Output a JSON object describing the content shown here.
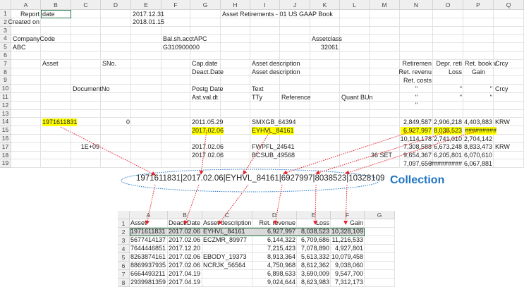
{
  "top_sheet": {
    "columns": [
      "A",
      "B",
      "C",
      "D",
      "E",
      "F",
      "G",
      "H",
      "I",
      "J",
      "K",
      "L",
      "M",
      "N",
      "O",
      "P",
      "Q"
    ],
    "rows": 19,
    "cells": [
      {
        "r": 1,
        "c": "A",
        "v": "Report",
        "a": "r"
      },
      {
        "r": 1,
        "c": "B",
        "v": "date"
      },
      {
        "r": 1,
        "c": "E",
        "v": "2017.12.31"
      },
      {
        "r": 1,
        "c": "H",
        "v": "Asset Retirements - 01 US GAAP Book"
      },
      {
        "r": 2,
        "c": "A",
        "v": "Created on",
        "a": "r"
      },
      {
        "r": 2,
        "c": "E",
        "v": "2018.01.15"
      },
      {
        "r": 4,
        "c": "A",
        "v": "CompanyCode"
      },
      {
        "r": 4,
        "c": "F",
        "v": "Bal.sh.acctAPC"
      },
      {
        "r": 4,
        "c": "K",
        "v": "Assetclass"
      },
      {
        "r": 5,
        "c": "A",
        "v": "ABC"
      },
      {
        "r": 5,
        "c": "F",
        "v": "G310900000"
      },
      {
        "r": 5,
        "c": "K",
        "v": "32061",
        "a": "r"
      },
      {
        "r": 7,
        "c": "B",
        "v": "Asset"
      },
      {
        "r": 7,
        "c": "D",
        "v": "SNo."
      },
      {
        "r": 7,
        "c": "G",
        "v": "Cap.date"
      },
      {
        "r": 7,
        "c": "I",
        "v": "Asset description"
      },
      {
        "r": 7,
        "c": "N",
        "v": "Retiremen",
        "a": "r"
      },
      {
        "r": 7,
        "c": "O",
        "v": "Depr. reti",
        "a": "r"
      },
      {
        "r": 7,
        "c": "P",
        "v": "Ret. book v"
      },
      {
        "r": 7,
        "c": "Q",
        "v": "Crcy"
      },
      {
        "r": 8,
        "c": "G",
        "v": "Deact.Date"
      },
      {
        "r": 8,
        "c": "I",
        "v": "Asset description"
      },
      {
        "r": 8,
        "c": "N",
        "v": "Ret. revenu",
        "a": "r"
      },
      {
        "r": 8,
        "c": "O",
        "v": "Loss",
        "a": "r"
      },
      {
        "r": 8,
        "c": "P",
        "v": "Gain",
        "a": "c"
      },
      {
        "r": 9,
        "c": "N",
        "v": "Ret. costs",
        "a": "r"
      },
      {
        "r": 10,
        "c": "C",
        "v": "DocumentNo"
      },
      {
        "r": 10,
        "c": "G",
        "v": "Postg Date"
      },
      {
        "r": 10,
        "c": "I",
        "v": "Text"
      },
      {
        "r": 10,
        "c": "N",
        "v": "\"",
        "a": "c"
      },
      {
        "r": 10,
        "c": "O",
        "v": "\"",
        "a": "r"
      },
      {
        "r": 10,
        "c": "P",
        "v": "\"",
        "a": "r"
      },
      {
        "r": 10,
        "c": "Q",
        "v": "Crcy"
      },
      {
        "r": 11,
        "c": "G",
        "v": "Ast.val.dt"
      },
      {
        "r": 11,
        "c": "I",
        "v": "TTy"
      },
      {
        "r": 11,
        "c": "J",
        "v": "Reference"
      },
      {
        "r": 11,
        "c": "L",
        "v": "Quant BUn"
      },
      {
        "r": 11,
        "c": "N",
        "v": "\"",
        "a": "c"
      },
      {
        "r": 11,
        "c": "O",
        "v": "\"",
        "a": "r"
      },
      {
        "r": 11,
        "c": "P",
        "v": "\"",
        "a": "r"
      },
      {
        "r": 12,
        "c": "N",
        "v": "\"",
        "a": "c"
      },
      {
        "r": 14,
        "c": "B",
        "v": "1971611831",
        "hl": true
      },
      {
        "r": 14,
        "c": "D",
        "v": "0",
        "a": "r"
      },
      {
        "r": 14,
        "c": "G",
        "v": "2011.05.29"
      },
      {
        "r": 14,
        "c": "I",
        "v": "SMXGB_64394"
      },
      {
        "r": 14,
        "c": "N",
        "v": "2,849,587",
        "a": "r"
      },
      {
        "r": 14,
        "c": "O",
        "v": "2,906,218",
        "a": "r"
      },
      {
        "r": 14,
        "c": "P",
        "v": "4,403,883",
        "a": "r"
      },
      {
        "r": 14,
        "c": "Q",
        "v": "KRW"
      },
      {
        "r": 15,
        "c": "G",
        "v": "2017.02.06",
        "hl": true
      },
      {
        "r": 15,
        "c": "I",
        "v": "EYHVL_84161",
        "hl": true
      },
      {
        "r": 15,
        "c": "N",
        "v": "6,927,997",
        "a": "r",
        "hl": true
      },
      {
        "r": 15,
        "c": "O",
        "v": "8,038,523",
        "a": "r",
        "hl": true
      },
      {
        "r": 15,
        "c": "P",
        "v": "#########",
        "hl": true
      },
      {
        "r": 16,
        "c": "N",
        "v": "10,114,178",
        "a": "r"
      },
      {
        "r": 16,
        "c": "O",
        "v": "2,741,010",
        "a": "r"
      },
      {
        "r": 16,
        "c": "P",
        "v": "2,704,142",
        "a": "r"
      },
      {
        "r": 17,
        "c": "C",
        "v": "1E+09",
        "a": "r"
      },
      {
        "r": 17,
        "c": "G",
        "v": "2017.02.06"
      },
      {
        "r": 17,
        "c": "I",
        "v": "FWPFL_24541"
      },
      {
        "r": 17,
        "c": "N",
        "v": "7,308,588",
        "a": "r"
      },
      {
        "r": 17,
        "c": "O",
        "v": "6,673,248",
        "a": "r"
      },
      {
        "r": 17,
        "c": "P",
        "v": "8,833,473",
        "a": "r"
      },
      {
        "r": 17,
        "c": "Q",
        "v": "KRW"
      },
      {
        "r": 18,
        "c": "G",
        "v": "2017.02.06"
      },
      {
        "r": 18,
        "c": "I",
        "v": "BCSUB_49568"
      },
      {
        "r": 18,
        "c": "M",
        "v": "36 SET"
      },
      {
        "r": 18,
        "c": "N",
        "v": "9,654,367",
        "a": "r"
      },
      {
        "r": 18,
        "c": "O",
        "v": "6,205,801",
        "a": "r"
      },
      {
        "r": 18,
        "c": "P",
        "v": "6,070,610",
        "a": "r"
      },
      {
        "r": 19,
        "c": "N",
        "v": "7,097,656",
        "a": "r"
      },
      {
        "r": 19,
        "c": "O",
        "v": "#########",
        "a": "r"
      },
      {
        "r": 19,
        "c": "P",
        "v": "6,067,881",
        "a": "r"
      }
    ]
  },
  "collection": {
    "string": "1971611831|2017.02.06|EYHVL_84161|6927997|8038523|10328109",
    "label": "Collection"
  },
  "bottom_sheet": {
    "columns": [
      "A",
      "B",
      "C",
      "D",
      "E",
      "F",
      "G"
    ],
    "header": [
      "Asset",
      "Deact.Date",
      "Asset description",
      "Ret. revenue",
      "Loss",
      "Gain"
    ],
    "rows": [
      [
        "1971611831",
        "2017.02.06",
        "EYHVL_84161",
        "6,927,997",
        "8,038,523",
        "10,328,109"
      ],
      [
        "5677414137",
        "2017.02.06",
        "ECZMR_89977",
        "6,144,322",
        "6,709,686",
        "11,216,533"
      ],
      [
        "7644446851",
        "2017.12.20",
        "",
        "7,215,423",
        "7,078,890",
        "4,927,801"
      ],
      [
        "8263874161",
        "2017.02.06",
        "EBODY_19373",
        "8,913,364",
        "5,613,332",
        "10,079,458"
      ],
      [
        "8869937935",
        "2017.02.06",
        "NCRJK_56564",
        "4,750,968",
        "8,612,362",
        "9,038,060"
      ],
      [
        "6664493211",
        "2017.04.19",
        "",
        "6,898,633",
        "3,690,009",
        "9,547,700"
      ],
      [
        "2939981359",
        "2017.04.19",
        "",
        "9,024,644",
        "8,623,983",
        "7,312,173"
      ]
    ],
    "selected_row": 2
  },
  "colors": {
    "highlight": "#ffff00",
    "arrow": "#e8202a",
    "ellipse": "#1f74c4",
    "selection": "#217346"
  }
}
